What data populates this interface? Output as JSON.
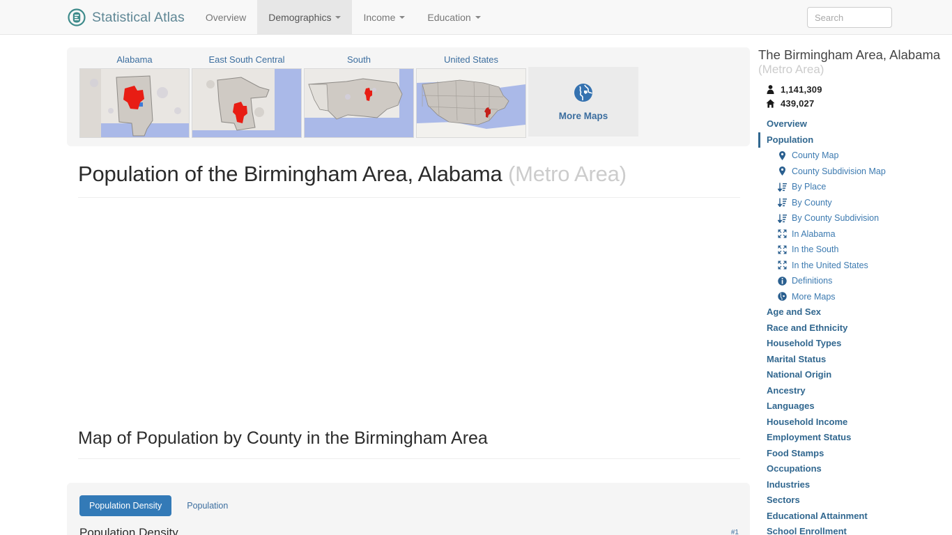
{
  "navbar": {
    "brand": "Statistical Atlas",
    "brand_icon": "atlas-logo-icon",
    "items": [
      {
        "label": "Overview",
        "caret": false,
        "active": false
      },
      {
        "label": "Demographics",
        "caret": true,
        "active": true
      },
      {
        "label": "Income",
        "caret": true,
        "active": false
      },
      {
        "label": "Education",
        "caret": true,
        "active": false
      }
    ],
    "search_placeholder": "Search",
    "search_value": ""
  },
  "maps_panel": {
    "thumbnails": [
      {
        "label": "Alabama",
        "name": "map-thumb-alabama"
      },
      {
        "label": "East South Central",
        "name": "map-thumb-east-south-central"
      },
      {
        "label": "South",
        "name": "map-thumb-south"
      },
      {
        "label": "United States",
        "name": "map-thumb-united-states"
      }
    ],
    "more_maps_label": "More Maps",
    "more_maps_icon": "globe-icon"
  },
  "main": {
    "title_primary": "Population of the Birmingham Area, Alabama",
    "title_muted": "(Metro Area)",
    "section_title": "Map of Population by County in the Birmingham Area",
    "figure": {
      "tabs": [
        {
          "label": "Population Density",
          "active": true
        },
        {
          "label": "Population",
          "active": false
        }
      ],
      "caption": "Population Density",
      "anchor": "#1"
    }
  },
  "sidebar": {
    "title": "The Birmingham Area, Alabama",
    "subtitle": "(Metro Area)",
    "stats": [
      {
        "icon": "person-icon",
        "glyph": "\u0001",
        "value": "1,141,309"
      },
      {
        "icon": "home-icon",
        "glyph": "\u0002",
        "value": "439,027"
      }
    ],
    "overview_label": "Overview",
    "current_label": "Population",
    "sub_items": [
      {
        "label": "County Map",
        "icon": "map-marker-icon"
      },
      {
        "label": "County Subdivision Map",
        "icon": "map-marker-icon"
      },
      {
        "label": "By Place",
        "icon": "sort-amount-icon"
      },
      {
        "label": "By County",
        "icon": "sort-amount-icon"
      },
      {
        "label": "By County Subdivision",
        "icon": "sort-amount-icon"
      },
      {
        "label": "In Alabama",
        "icon": "expand-arrows-icon"
      },
      {
        "label": "In the South",
        "icon": "expand-arrows-icon"
      },
      {
        "label": "In the United States",
        "icon": "expand-arrows-icon"
      },
      {
        "label": "Definitions",
        "icon": "info-circle-icon"
      },
      {
        "label": "More Maps",
        "icon": "globe-icon"
      }
    ],
    "sections": [
      {
        "label": "Age and Sex"
      },
      {
        "label": "Race and Ethnicity"
      },
      {
        "label": "Household Types"
      },
      {
        "label": "Marital Status"
      },
      {
        "label": "National Origin"
      },
      {
        "label": "Ancestry"
      },
      {
        "label": "Languages"
      },
      {
        "label": "Household Income"
      },
      {
        "label": "Employment Status"
      },
      {
        "label": "Food Stamps"
      },
      {
        "label": "Occupations"
      },
      {
        "label": "Industries"
      },
      {
        "label": "Sectors"
      },
      {
        "label": "Educational Attainment"
      },
      {
        "label": "School Enrollment"
      }
    ]
  },
  "colors": {
    "brand_teal": "#3e8b8b",
    "link_blue": "#3c6e9f",
    "active_tab_blue": "#337ab7",
    "sidebar_blue": "#31678f",
    "highlight_red": "#e81d14",
    "water_blue": "#aab9e8"
  }
}
